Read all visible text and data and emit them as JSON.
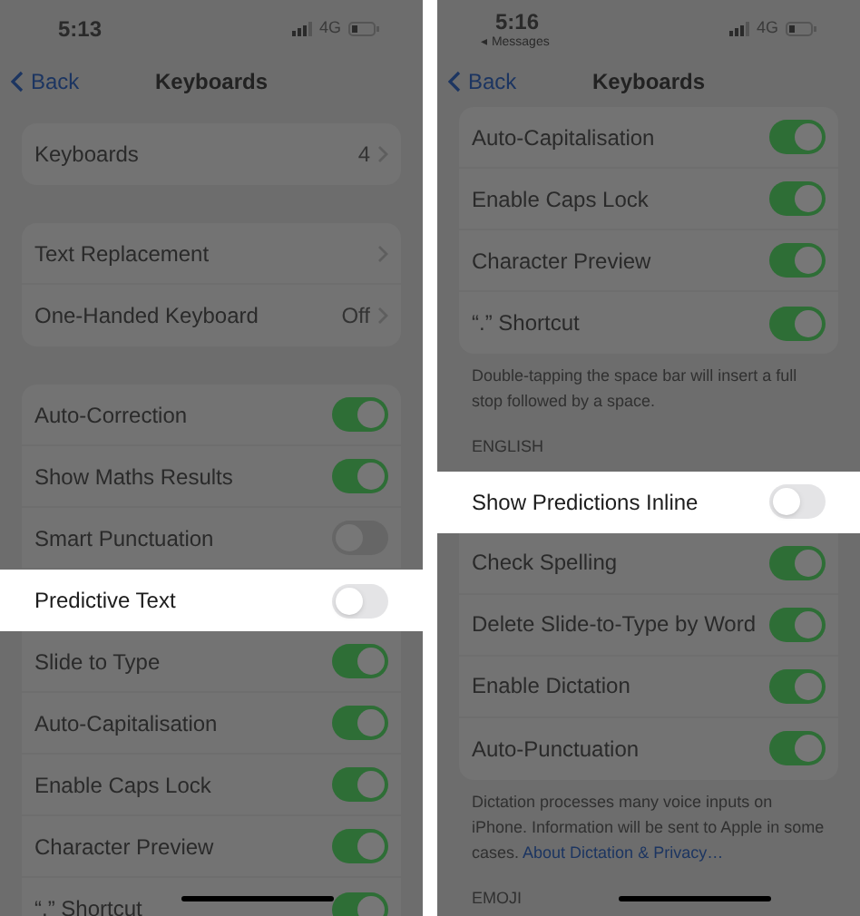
{
  "panels": [
    {
      "status": {
        "time": "5:13",
        "network": "4G"
      },
      "nav": {
        "back": "Back",
        "title": "Keyboards"
      },
      "sections": [
        {
          "rows": [
            {
              "label": "Keyboards",
              "kind": "link",
              "value": "4",
              "highlighted": false
            }
          ]
        },
        {
          "rows": [
            {
              "label": "Text Replacement",
              "kind": "link",
              "highlighted": false
            },
            {
              "label": "One-Handed Keyboard",
              "kind": "link",
              "value": "Off",
              "highlighted": false
            }
          ]
        },
        {
          "rows": [
            {
              "label": "Auto-Correction",
              "kind": "toggle",
              "on": true,
              "highlighted": false
            },
            {
              "label": "Show Maths Results",
              "kind": "toggle",
              "on": true,
              "highlighted": false
            },
            {
              "label": "Smart Punctuation",
              "kind": "toggle",
              "on": false,
              "highlighted": false
            },
            {
              "label": "Predictive Text",
              "kind": "toggle",
              "on": false,
              "highlighted": true
            },
            {
              "label": "Slide to Type",
              "kind": "toggle",
              "on": true,
              "highlighted": false
            },
            {
              "label": "Auto-Capitalisation",
              "kind": "toggle",
              "on": true,
              "highlighted": false
            },
            {
              "label": "Enable Caps Lock",
              "kind": "toggle",
              "on": true,
              "highlighted": false
            },
            {
              "label": "Character Preview",
              "kind": "toggle",
              "on": true,
              "highlighted": false
            },
            {
              "label": "“.” Shortcut",
              "kind": "toggle",
              "on": true,
              "highlighted": false
            }
          ]
        }
      ]
    },
    {
      "status": {
        "time": "5:16",
        "return_app": "◂ Messages",
        "network": "4G"
      },
      "nav": {
        "back": "Back",
        "title": "Keyboards"
      },
      "sections": [
        {
          "rows": [
            {
              "label": "Auto-Capitalisation",
              "kind": "toggle",
              "on": true,
              "highlighted": false
            },
            {
              "label": "Enable Caps Lock",
              "kind": "toggle",
              "on": true,
              "highlighted": false
            },
            {
              "label": "Character Preview",
              "kind": "toggle",
              "on": true,
              "highlighted": false
            },
            {
              "label": "“.” Shortcut",
              "kind": "toggle",
              "on": true,
              "highlighted": false
            }
          ],
          "footer": "Double-tapping the space bar will insert a full stop followed by a space."
        },
        {
          "header": "ENGLISH",
          "rows": [
            {
              "label": "Show Predictions Inline",
              "kind": "toggle",
              "on": false,
              "highlighted": true
            },
            {
              "label": "Check Spelling",
              "kind": "toggle",
              "on": true,
              "highlighted": false
            },
            {
              "label": "Delete Slide-to-Type by Word",
              "kind": "toggle",
              "on": true,
              "highlighted": false
            },
            {
              "label": "Enable Dictation",
              "kind": "toggle",
              "on": true,
              "highlighted": false
            },
            {
              "label": "Auto-Punctuation",
              "kind": "toggle",
              "on": true,
              "highlighted": false
            }
          ],
          "footer": "Dictation processes many voice inputs on iPhone. Information will be sent to Apple in some cases.",
          "footer_link": "About Dictation & Privacy…"
        },
        {
          "header": "EMOJI"
        }
      ]
    }
  ]
}
